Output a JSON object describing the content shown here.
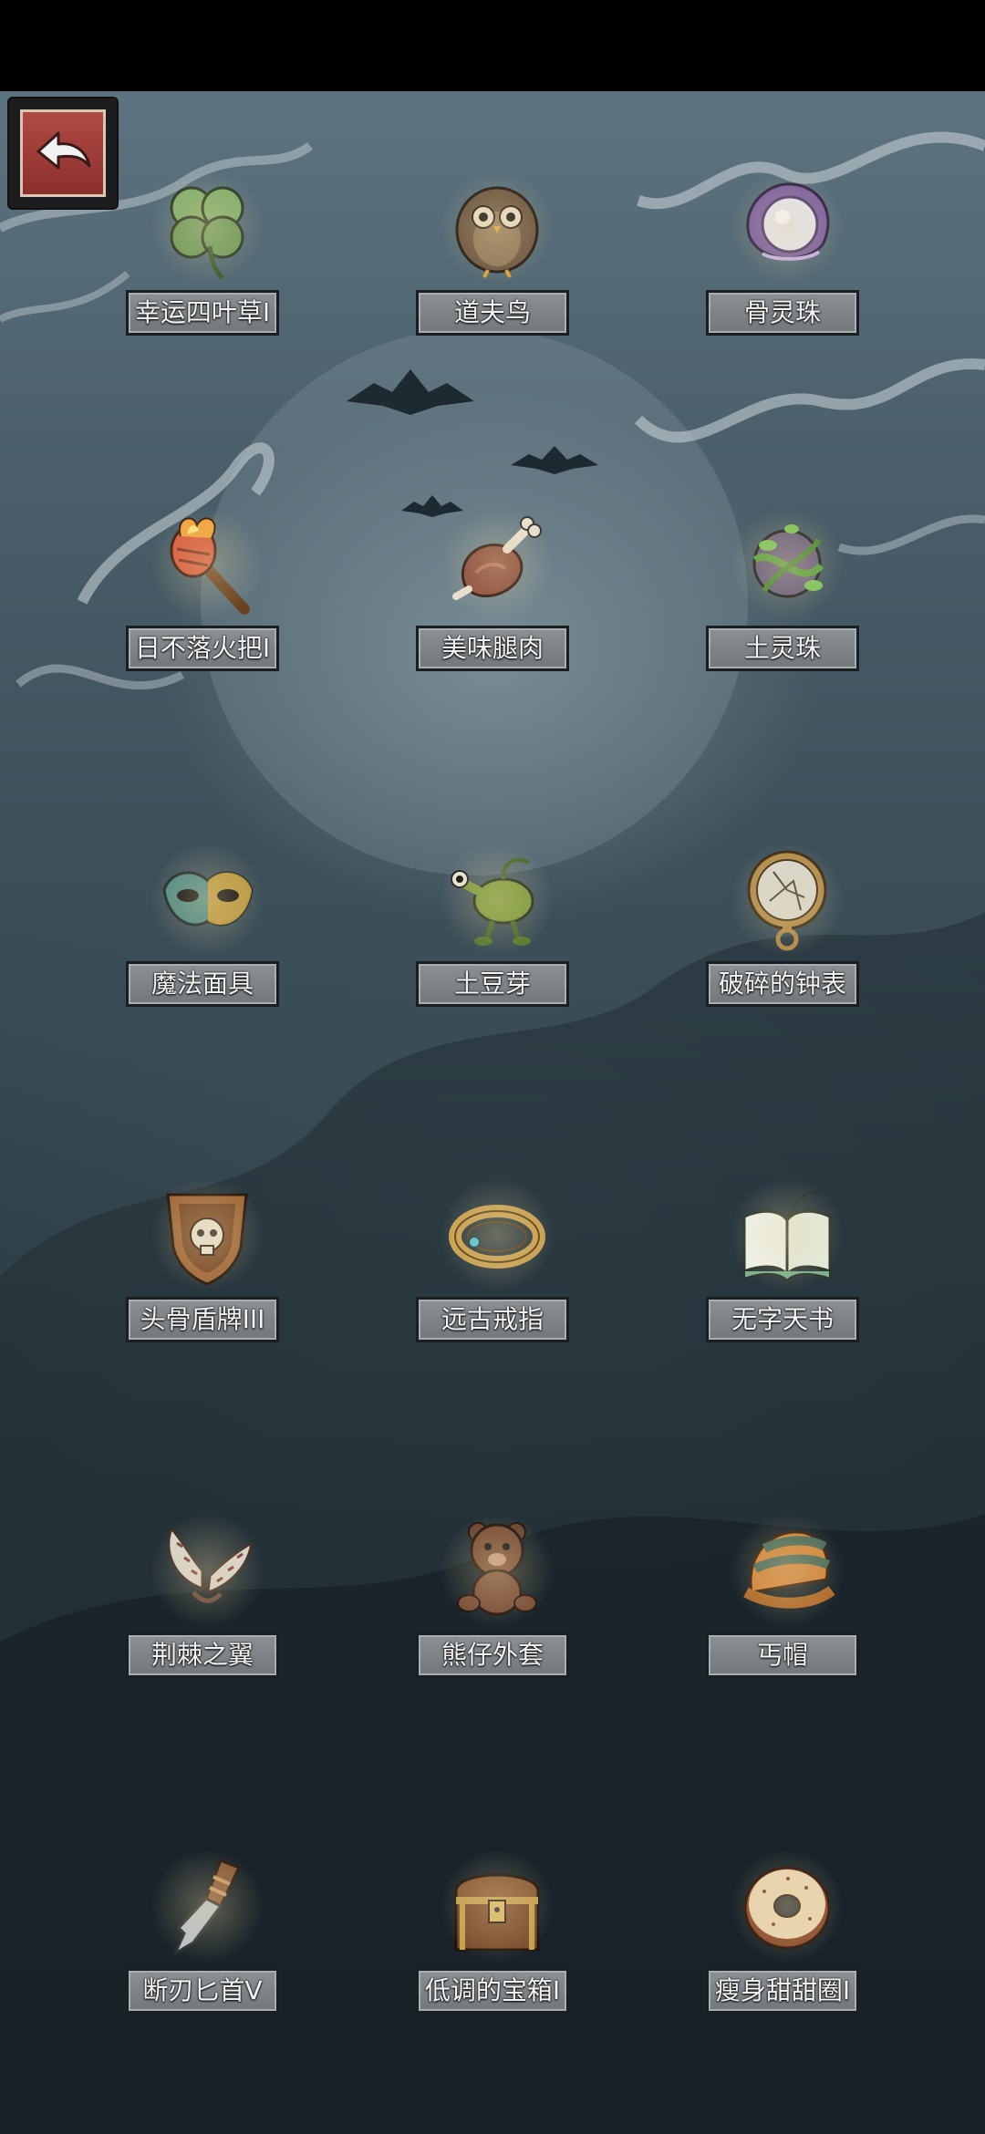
{
  "items": [
    {
      "label": "幸运四叶草I",
      "icon": "clover-icon"
    },
    {
      "label": "道夫鸟",
      "icon": "owl-icon"
    },
    {
      "label": "骨灵珠",
      "icon": "bone-orb-icon"
    },
    {
      "label": "日不落火把I",
      "icon": "torch-icon"
    },
    {
      "label": "美味腿肉",
      "icon": "meat-leg-icon"
    },
    {
      "label": "土灵珠",
      "icon": "earth-orb-icon"
    },
    {
      "label": "魔法面具",
      "icon": "mask-icon"
    },
    {
      "label": "土豆芽",
      "icon": "potato-sprout-icon"
    },
    {
      "label": "破碎的钟表",
      "icon": "broken-watch-icon"
    },
    {
      "label": "头骨盾牌III",
      "icon": "skull-shield-icon"
    },
    {
      "label": "远古戒指",
      "icon": "ring-icon"
    },
    {
      "label": "无字天书",
      "icon": "blank-book-icon"
    },
    {
      "label": "荆棘之翼",
      "icon": "thorn-wings-icon"
    },
    {
      "label": "熊仔外套",
      "icon": "bear-coat-icon"
    },
    {
      "label": "丐帽",
      "icon": "beggar-hat-icon"
    },
    {
      "label": "断刃匕首V",
      "icon": "broken-dagger-icon"
    },
    {
      "label": "低调的宝箱I",
      "icon": "treasure-chest-icon"
    },
    {
      "label": "瘦身甜甜圈I",
      "icon": "donut-icon"
    }
  ],
  "colors": {
    "back_button": "#a03c38",
    "label_bg": "#7d8387",
    "background_top": "#5d7480",
    "background_bottom": "#1a252b"
  }
}
